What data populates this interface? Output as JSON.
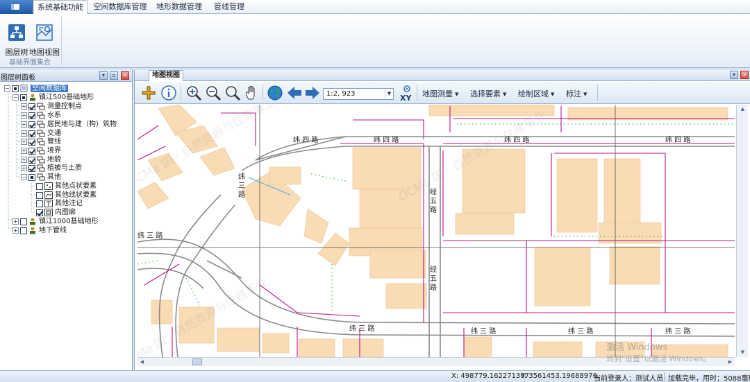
{
  "ribbon": {
    "tabs": [
      {
        "label": "系统基础功能",
        "active": true
      },
      {
        "label": "空间数据库管理",
        "active": false
      },
      {
        "label": "地形数据管理",
        "active": false
      },
      {
        "label": "管线管理",
        "active": false
      }
    ],
    "buttons": [
      {
        "label": "图层树",
        "icon": "layer-tree-icon"
      },
      {
        "label": "地图视图",
        "icon": "map-view-icon"
      }
    ],
    "group_label": "基础界面集合"
  },
  "left_panel": {
    "title": "图层树面板",
    "tree": [
      {
        "label": "空间数据库",
        "level": 0,
        "selected": true
      },
      {
        "label": "镇江500基础地形",
        "level": 1
      },
      {
        "label": "测量控制点",
        "level": 2
      },
      {
        "label": "水系",
        "level": 2
      },
      {
        "label": "居民地与建（构）筑物",
        "level": 2
      },
      {
        "label": "交通",
        "level": 2
      },
      {
        "label": "管线",
        "level": 2
      },
      {
        "label": "境界",
        "level": 2
      },
      {
        "label": "地貌",
        "level": 2
      },
      {
        "label": "植被与土质",
        "level": 2
      },
      {
        "label": "其他",
        "level": 2
      },
      {
        "label": "其他点状要素",
        "level": 3
      },
      {
        "label": "其他线状要素",
        "level": 3
      },
      {
        "label": "其他注记",
        "level": 3
      },
      {
        "label": "内图廓",
        "level": 3
      },
      {
        "label": "镇江1000基础地形",
        "level": 1
      },
      {
        "label": "地下管线",
        "level": 1
      }
    ]
  },
  "map_panel": {
    "doc_tab": "地图视图",
    "scale": "1:2, 923",
    "xy_label": "XY",
    "menus": [
      "地图测量",
      "选择要素",
      "绘制区域",
      "标注"
    ]
  },
  "map": {
    "road_labels": [
      {
        "text": "纬 四 路"
      },
      {
        "text": "纬 四 路"
      },
      {
        "text": "纬 四 路"
      },
      {
        "text": "纬 四 路"
      },
      {
        "text": "纬 三 路"
      },
      {
        "text": "纬 三 路"
      },
      {
        "text": "纬 三 路"
      },
      {
        "text": "纬 三 路"
      },
      {
        "text": "纬 三 路"
      },
      {
        "text": "经 五 路"
      },
      {
        "text": "经 五 路"
      },
      {
        "text": "纬 三 路"
      }
    ]
  },
  "watermarks": [
    "OCMa 国 · 自然资源与住建事业",
    "OCMa 国 · 自然资源与住建事业",
    "OCMa 国 · 自然资源与住建事业"
  ],
  "windows_notice": {
    "line1": "激活 Windows",
    "line2": "转到\"设置\"以激活 Windows。"
  },
  "status": {
    "x": "X:  498779.162271307",
    "y": "Y:  3561453.19688976",
    "user": "当前登录人：测试人员",
    "load": "加载完毕，用时：5088毫秒"
  },
  "colors": {
    "building": "#f9dbb4",
    "road_line": "#8a8a8a",
    "boundary": "#c0108a",
    "green_dot": "#3fbf3f"
  }
}
